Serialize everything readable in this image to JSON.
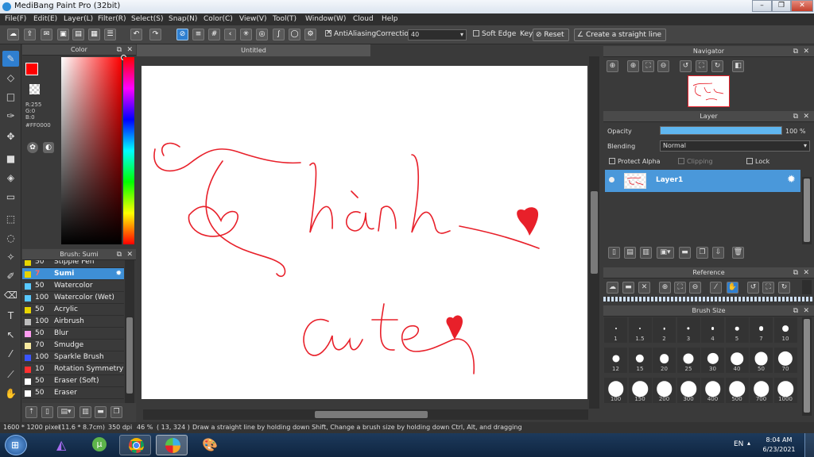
{
  "window": {
    "title": "MediBang Paint Pro (32bit)",
    "controls": [
      "–",
      "❐",
      "✕"
    ]
  },
  "menu": [
    "File(F)",
    "Edit(E)",
    "Layer(L)",
    "Filter(R)",
    "Select(S)",
    "Snap(N)",
    "Color(C)",
    "View(V)",
    "Tool(T)",
    "Window(W)",
    "Cloud",
    "Help"
  ],
  "toolbar": {
    "antialiasing_label": "AntiAliasing",
    "correction_label": "Correction",
    "correction_value": "40",
    "soft_edge_label": "Soft Edge",
    "key_label": "Key",
    "reset_label": "Reset",
    "straight_line_label": "Create a straight line"
  },
  "color_panel": {
    "title": "Color",
    "r": "R:255",
    "g": "G:0",
    "b": "B:0",
    "hex": "#FF0000",
    "primary": "#ff0000",
    "secondary": "#000000"
  },
  "brush_panel": {
    "title": "Brush: Sumi",
    "items": [
      {
        "size": "50",
        "name": "Stipple Pen",
        "color": "#e6d400"
      },
      {
        "size": "7",
        "name": "Sumi",
        "color": "#e6d400",
        "selected": true
      },
      {
        "size": "50",
        "name": "Watercolor",
        "color": "#58c8ff"
      },
      {
        "size": "100",
        "name": "Watercolor (Wet)",
        "color": "#58c8ff"
      },
      {
        "size": "50",
        "name": "Acrylic",
        "color": "#e6d400"
      },
      {
        "size": "100",
        "name": "Airbrush",
        "color": "#bdbdbd"
      },
      {
        "size": "50",
        "name": "Blur",
        "color": "#ff9cf0"
      },
      {
        "size": "70",
        "name": "Smudge",
        "color": "#f7e9a0"
      },
      {
        "size": "100",
        "name": "Sparkle Brush",
        "color": "#3a55ff"
      },
      {
        "size": "10",
        "name": "Rotation Symmetry P",
        "color": "#ff3030"
      },
      {
        "size": "50",
        "name": "Eraser (Soft)",
        "color": "#ffffff"
      },
      {
        "size": "50",
        "name": "Eraser",
        "color": "#ffffff"
      }
    ]
  },
  "document": {
    "tab": "Untitled"
  },
  "navigator": {
    "title": "Navigator"
  },
  "layer_panel": {
    "title": "Layer",
    "opacity_label": "Opacity",
    "opacity_value": "100 %",
    "opacity_fraction": 1.0,
    "blending_label": "Blending",
    "blending_value": "Normal",
    "protect_alpha": "Protect Alpha",
    "clipping": "Clipping",
    "lock": "Lock",
    "layer_name": "Layer1"
  },
  "reference": {
    "title": "Reference"
  },
  "brush_size": {
    "title": "Brush Size",
    "sizes": [
      "1",
      "1.5",
      "2",
      "3",
      "4",
      "5",
      "7",
      "10",
      "12",
      "15",
      "20",
      "25",
      "30",
      "40",
      "50",
      "70",
      "100",
      "150",
      "200",
      "300",
      "400",
      "500",
      "700",
      "1000"
    ]
  },
  "status": {
    "dims": "1600 * 1200 pixel",
    "cm": "(11.6 * 8.7cm)",
    "dpi": "350 dpi",
    "zoom": "46 %",
    "coords": "( 13, 324 )",
    "hint": "Draw a straight line by holding down Shift, Change a brush size by holding down Ctrl, Alt, and dragging"
  },
  "taskbar": {
    "lang": "EN",
    "time": "8:04 AM",
    "date": "6/23/2021"
  },
  "drawing_color": "#e8202a"
}
